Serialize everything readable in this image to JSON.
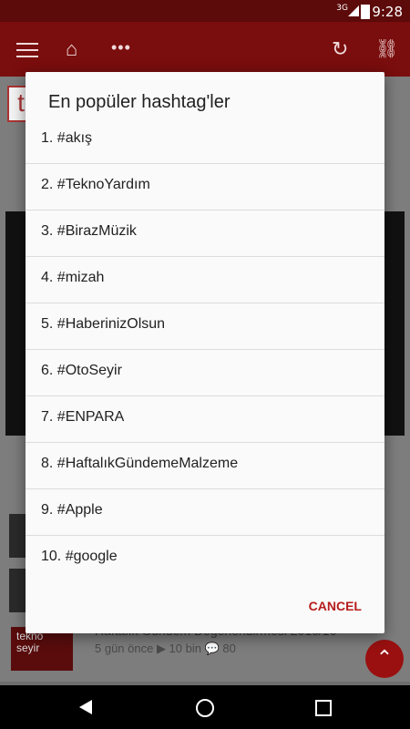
{
  "status": {
    "network": "3G",
    "time": "9:28"
  },
  "appbar": {
    "menu_icon": "menu-icon",
    "home_icon": "home-icon",
    "more_icon": "more-icon",
    "refresh_icon": "refresh-icon",
    "link_icon": "link-icon"
  },
  "dialog": {
    "title": "En popüler hashtag'ler",
    "items": [
      "1. #akış",
      "2. #TeknoYardım",
      "3. #BirazMüzik",
      "4. #mizah",
      "5. #HaberinizOlsun",
      "6. #OtoSeyir",
      "7. #ENPARA",
      "8. #HaftalıkGündemeMalzeme",
      "9. #Apple",
      "10. #google"
    ],
    "cancel_label": "CANCEL"
  },
  "background": {
    "logo_text": "t",
    "tekno_label": "tekno seyir",
    "item_title": "Haftalık Gündem Değerlendirmesi 2016/16",
    "item_meta": "5 gün önce   ▶ 10 bin   💬 80"
  },
  "colors": {
    "accent": "#b71c1c",
    "appbar": "#7a0d0d",
    "statusbar": "#5c0a0a"
  }
}
